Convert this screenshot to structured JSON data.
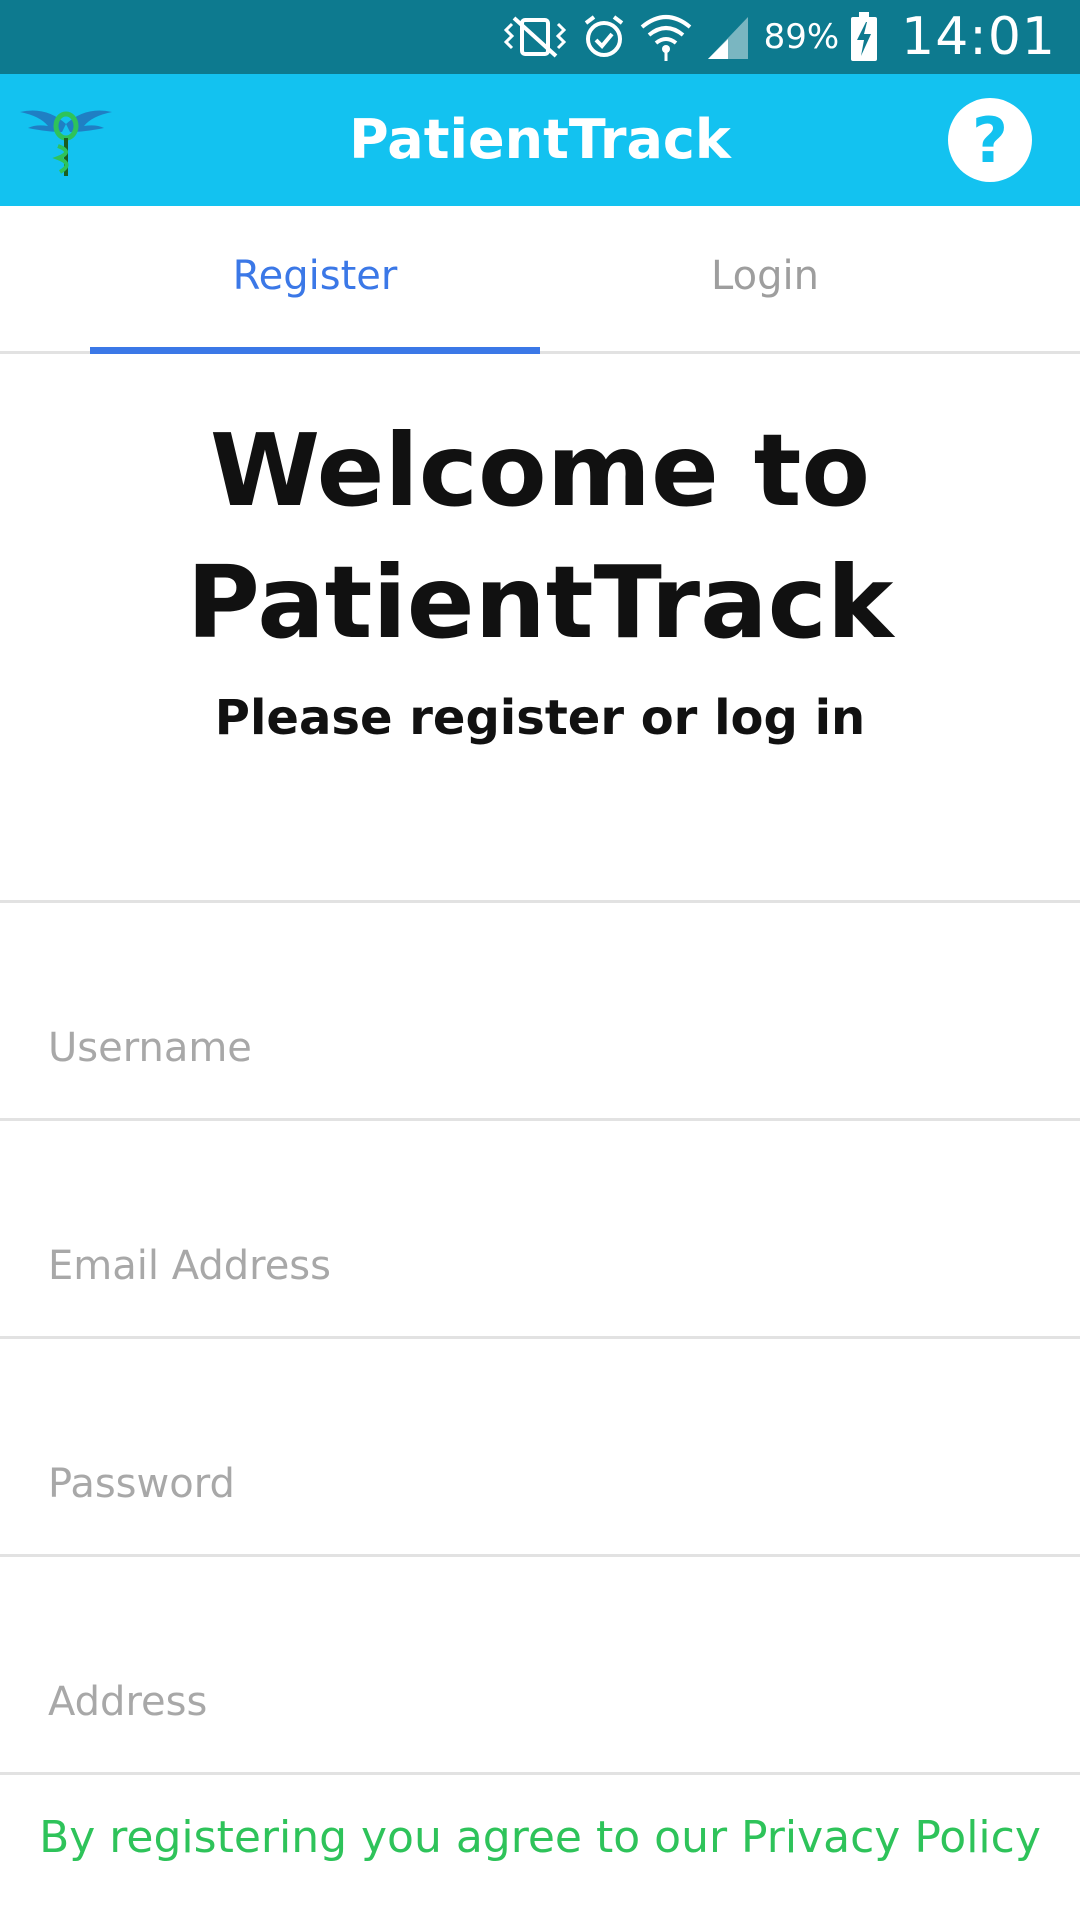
{
  "status_bar": {
    "battery_percent": "89%",
    "time": "14:01",
    "icons": [
      "vibrate-silent-icon",
      "alarm-icon",
      "wifi-icon",
      "signal-icon",
      "battery-charging-icon"
    ]
  },
  "app_bar": {
    "title": "PatientTrack",
    "help_label": "?",
    "logo_icon": "caduceus-logo-icon",
    "color": "#13c2f0"
  },
  "tabs": [
    {
      "label": "Register",
      "active": true
    },
    {
      "label": "Login",
      "active": false
    }
  ],
  "welcome": {
    "title_line1": "Welcome to",
    "title_line2": "PatientTrack",
    "subtitle": "Please register or log in"
  },
  "form": {
    "username_placeholder": "Username",
    "email_placeholder": "Email Address",
    "password_placeholder": "Password",
    "address_placeholder": "Address"
  },
  "footer": {
    "privacy_text": "By registering you agree to our Privacy Policy"
  },
  "colors": {
    "accent_blue": "#3b78e7",
    "status_bar": "#0d7a8f",
    "privacy_green": "#2ec35a"
  }
}
